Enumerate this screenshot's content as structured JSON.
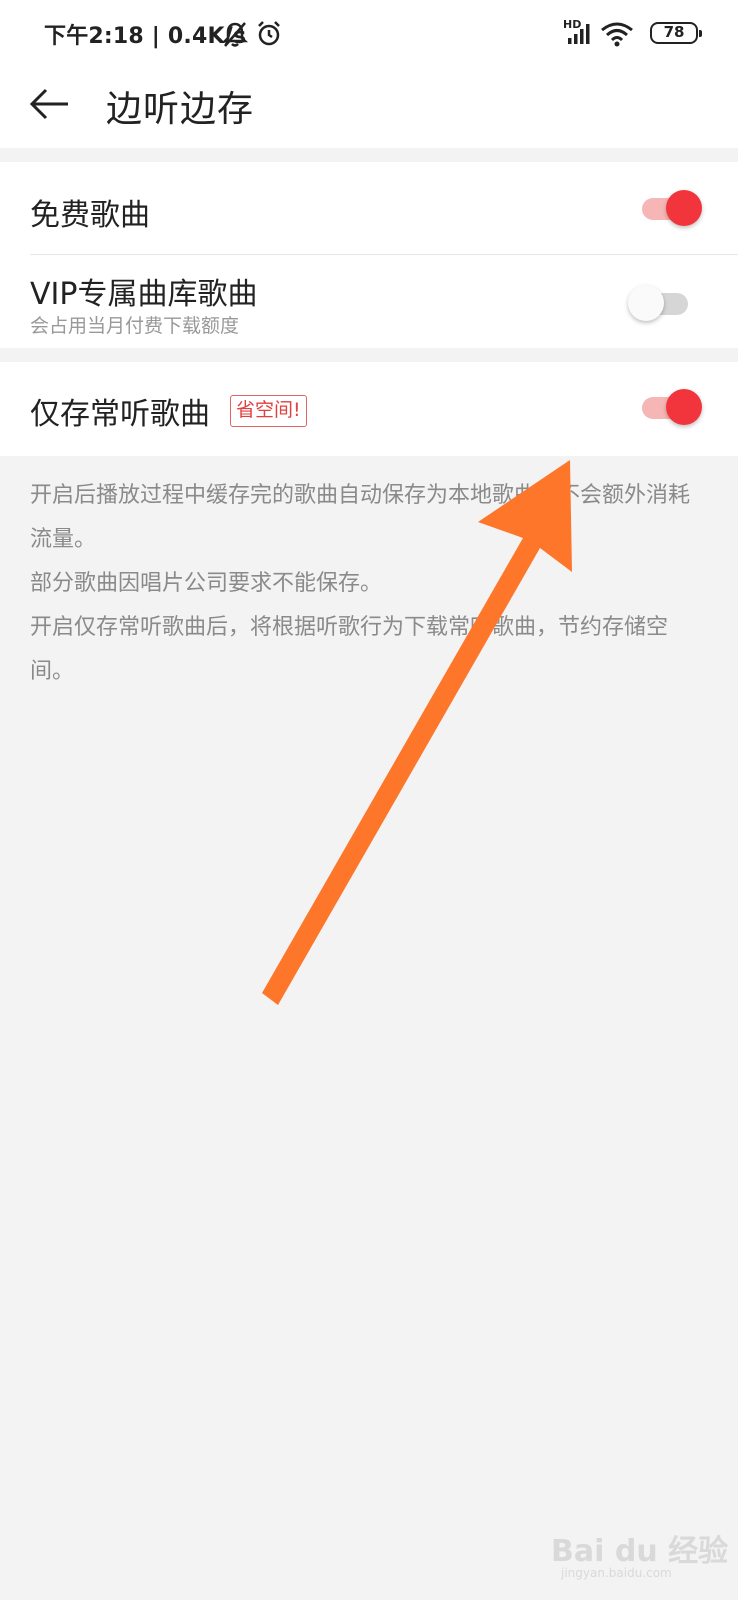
{
  "status_bar": {
    "time": "下午2:18",
    "speed": "0.4K/s",
    "separator": "|",
    "signal_label": "HD",
    "battery": "78"
  },
  "header": {
    "title": "边听边存",
    "back_icon": "arrow-left-icon"
  },
  "settings": {
    "free_songs": {
      "label": "免费歌曲",
      "enabled": true
    },
    "vip_songs": {
      "label": "VIP专属曲库歌曲",
      "sublabel": "会占用当月付费下载额度",
      "enabled": false
    },
    "frequent_songs": {
      "label": "仅存常听歌曲",
      "tag": "省空间!",
      "enabled": true
    }
  },
  "description": {
    "line1": "开启后播放过程中缓存完的歌曲自动保存为本地歌曲，不会额外消耗流量。",
    "line2": "部分歌曲因唱片公司要求不能保存。",
    "line3": "开启仅存常听歌曲后，将根据听歌行为下载常听歌曲，节约存储空间。"
  },
  "watermark": {
    "main": "Bai du 经验",
    "sub": "jingyan.baidu.com"
  },
  "colors": {
    "accent": "#f2353c",
    "accent_track": "#f7b6b6",
    "annotation_arrow": "#fd762a",
    "background": "#f3f3f3"
  }
}
